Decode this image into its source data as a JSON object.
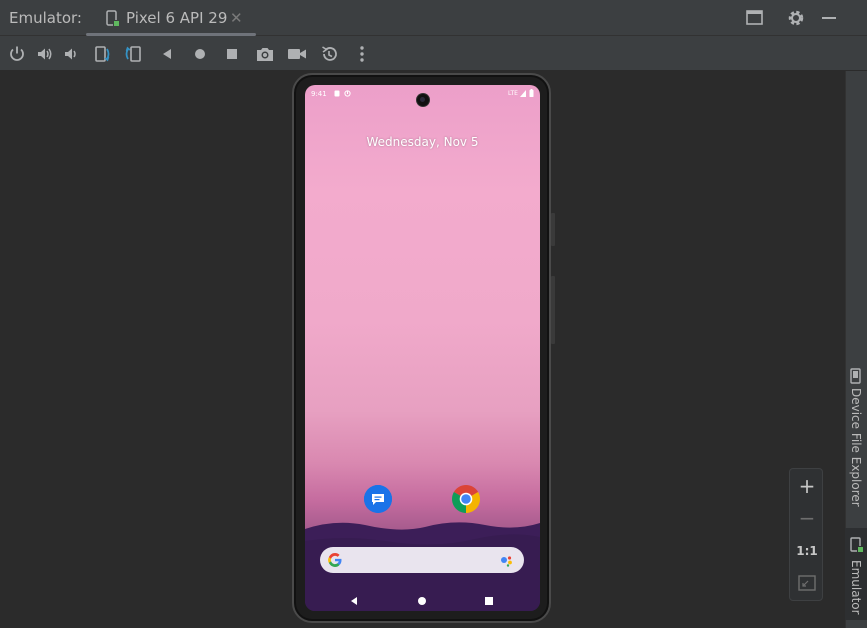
{
  "header": {
    "title": "Emulator:",
    "tab_title": "Pixel 6 API 29",
    "close_glyph": "✕"
  },
  "toolbar": {
    "buttons": [
      "power-icon",
      "volume-up-icon",
      "volume-down-icon",
      "rotate-left-icon",
      "rotate-right-icon",
      "back-icon",
      "home-icon",
      "overview-icon",
      "screenshot-icon",
      "screen-record-icon",
      "snapshot-icon",
      "more-icon"
    ]
  },
  "device": {
    "time": "9:41",
    "network": "LTE",
    "date": "Wednesday, Nov 5",
    "apps": [
      "messages-icon",
      "chrome-icon"
    ]
  },
  "zoom": {
    "zoom_in": "+",
    "zoom_out": "−",
    "actual_size": "1:1"
  },
  "sidebar": {
    "tabs": [
      {
        "label": "Device File Explorer"
      },
      {
        "label": "Emulator"
      }
    ]
  },
  "colors": {
    "accent_blue": "#3592c4",
    "background": "#2b2b2b",
    "panel": "#3c3f41"
  }
}
